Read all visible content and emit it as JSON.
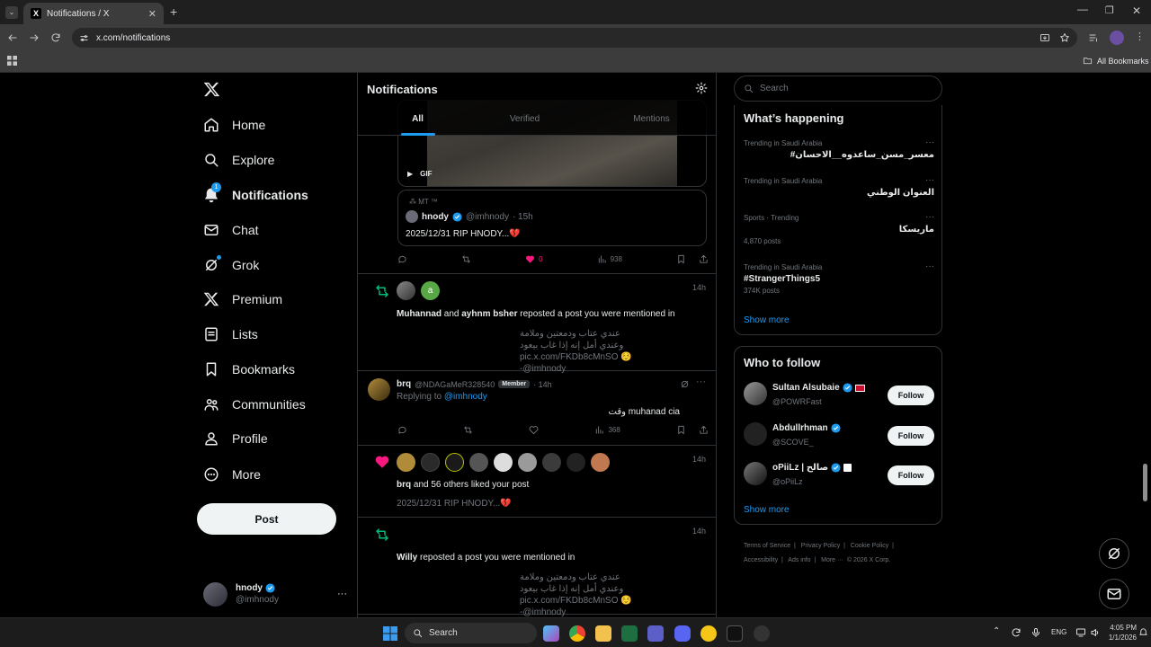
{
  "browser": {
    "tab_title": "Notifications / X",
    "url": "x.com/notifications",
    "bookmarks_label": "All Bookmarks"
  },
  "nav": {
    "items": [
      {
        "label": "Home"
      },
      {
        "label": "Explore"
      },
      {
        "label": "Notifications",
        "badge": "1"
      },
      {
        "label": "Chat"
      },
      {
        "label": "Grok"
      },
      {
        "label": "Premium"
      },
      {
        "label": "Lists"
      },
      {
        "label": "Bookmarks"
      },
      {
        "label": "Communities"
      },
      {
        "label": "Profile"
      },
      {
        "label": "More"
      }
    ],
    "post_label": "Post",
    "account": {
      "name": "hnody",
      "handle": "@imhnody",
      "more": "···"
    }
  },
  "main": {
    "title": "Notifications",
    "tabs": [
      {
        "label": "All"
      },
      {
        "label": "Verified"
      },
      {
        "label": "Mentions"
      }
    ],
    "gif_label": "GIF",
    "quote": {
      "context": "MT ™",
      "name": "hnody",
      "handle": "@imhnody",
      "time": "· 15h",
      "text": "2025/12/31 RIP HNODY...💔"
    },
    "post1_actions": {
      "likes": "0",
      "views": "938"
    },
    "repost1": {
      "time": "14h",
      "avatar_letter": "a",
      "user1": "Muhannad",
      "and": "and",
      "user2": "ayhnm bsher",
      "action": "reposted a post you were mentioned in",
      "lines": [
        "عندي عتاب ودمعتين وملامة",
        "وعندي أمل إنه إذا غاب بيعود",
        "pic.x.com/FKDb8cMnSO ☺️ @imhnody-"
      ]
    },
    "reply": {
      "name": "brq",
      "handle": "@NDAGaMeR328540",
      "badge": "Member",
      "time": "· 14h",
      "replying": "Replying to",
      "replying_to": "@imhnody",
      "text": "وقت muhanad cia",
      "views": "368"
    },
    "like": {
      "time": "14h",
      "user": "brq",
      "text": "and 56 others liked your post",
      "quote": "2025/12/31 RIP HNODY...💔"
    },
    "repost2": {
      "time": "14h",
      "user": "Willy",
      "action": "reposted a post you were mentioned in",
      "lines": [
        "عندي عتاب ودمعتين وملامة",
        "وعندي أمل إنه إذا غاب بيعود",
        "pic.x.com/FKDb8cMnSO ☺️ @imhnody-"
      ]
    }
  },
  "right": {
    "search_placeholder": "Search",
    "happening": {
      "title": "What’s happening",
      "trends": [
        {
          "category": "Trending in Saudi Arabia",
          "name": "#معسر_مسن_ساعدوه__الاحسان",
          "count": ""
        },
        {
          "category": "Trending in Saudi Arabia",
          "name": "العنوان الوطني",
          "count": ""
        },
        {
          "category": "Sports · Trending",
          "name": "ماريسكا",
          "count": "4,870 posts"
        },
        {
          "category": "Trending in Saudi Arabia",
          "name": "#StrangerThings5",
          "count": "374K posts"
        }
      ],
      "show_more": "Show more"
    },
    "who_to_follow": {
      "title": "Who to follow",
      "users": [
        {
          "name": "Sultan Alsubaie",
          "handle": "@POWRFast",
          "button": "Follow"
        },
        {
          "name": "Abdullrhman",
          "handle": "@SCOVE_",
          "button": "Follow"
        },
        {
          "name": "oPiiLz | صالح",
          "handle": "@oPiiLz",
          "button": "Follow"
        }
      ],
      "show_more": "Show more"
    },
    "footer": {
      "line1": [
        "Terms of Service",
        "Privacy Policy",
        "Cookie Policy"
      ],
      "line2": [
        "Accessibility",
        "Ads info",
        "More ···",
        "© 2026 X Corp."
      ]
    }
  },
  "taskbar": {
    "search": "Search",
    "lang": "ENG",
    "time": "4:05 PM",
    "date": "1/1/2026"
  },
  "colors": {
    "accent": "#1d9bf0",
    "like": "#f91880",
    "repost": "#00ba7c"
  }
}
